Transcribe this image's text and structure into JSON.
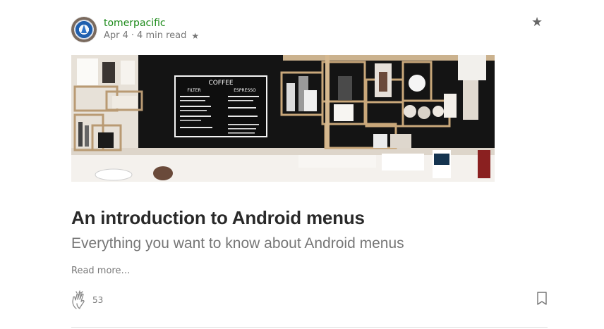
{
  "post": {
    "author": "tomerpacific",
    "date": "Apr 4",
    "separator": "·",
    "read_time": "4 min read",
    "member_star": "★",
    "top_star": "★",
    "title": "An introduction to Android menus",
    "subtitle": "Everything you want to know about Android menus",
    "read_more": "Read more…",
    "claps": "53",
    "icons": {
      "avatar": "avatar-image",
      "member": "star-icon",
      "clap": "clap-icon",
      "bookmark": "bookmark-icon"
    },
    "colors": {
      "author": "#1a8917",
      "muted": "#757575",
      "title": "#292929"
    }
  },
  "hero_image": {
    "board_heading": "COFFEE",
    "board_left_heading": "FILTER",
    "board_right_heading": "ESPRESSO"
  }
}
